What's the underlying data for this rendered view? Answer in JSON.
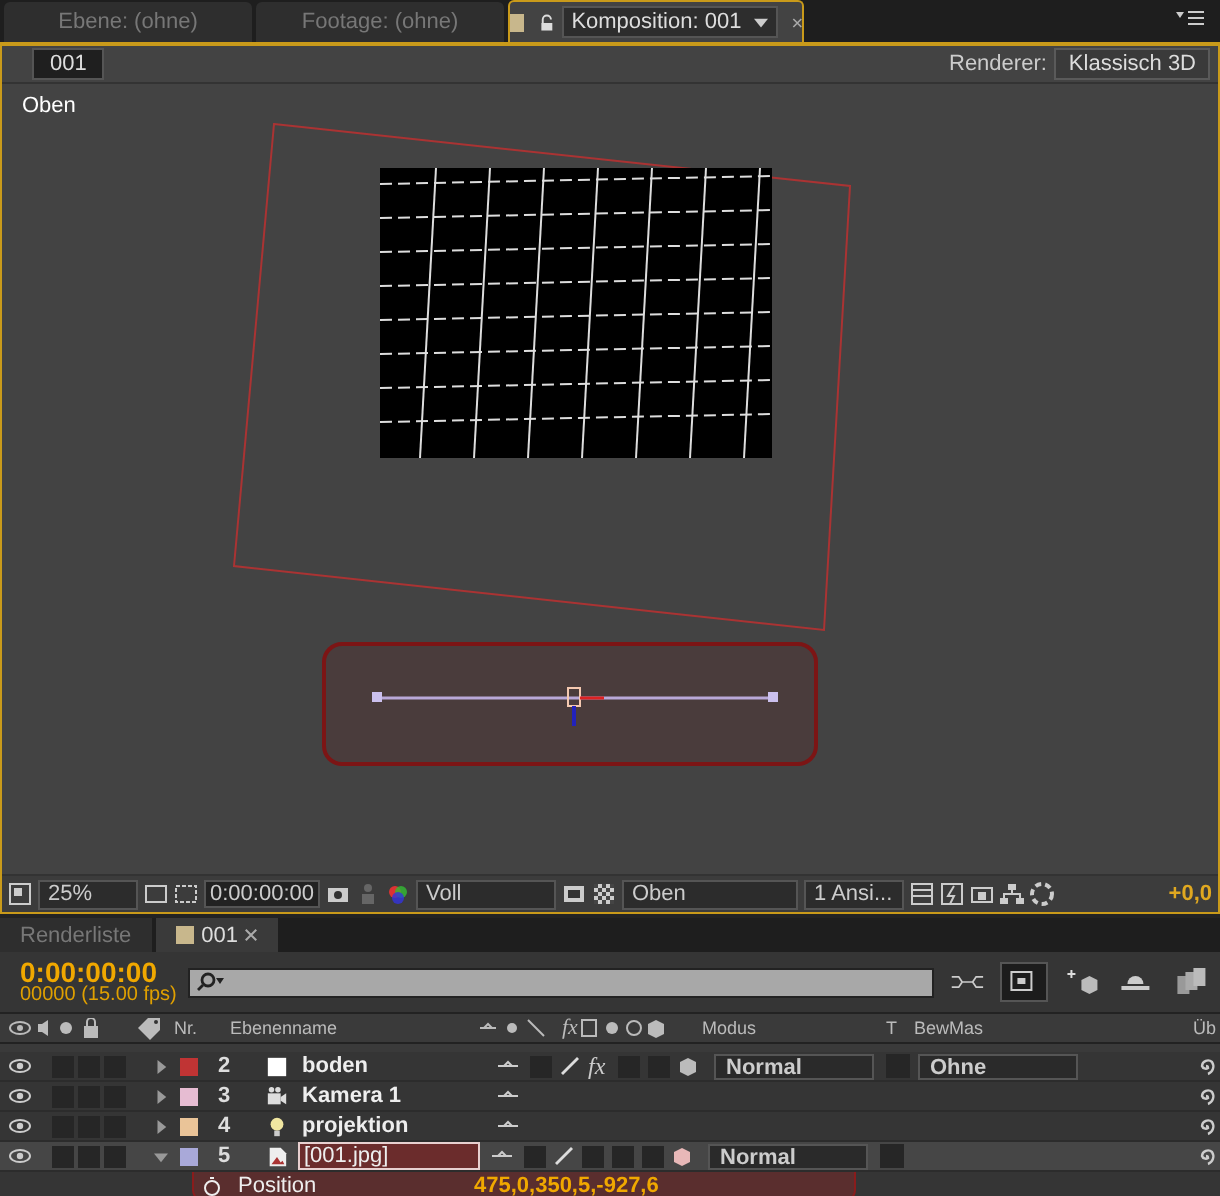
{
  "panel_tabs": [
    {
      "label": "Ebene: (ohne)",
      "selected": false
    },
    {
      "label": "Footage: (ohne)",
      "selected": false
    },
    {
      "label": "Komposition: 001",
      "selected": true
    }
  ],
  "comp_header": {
    "comp_name": "001",
    "renderer_label": "Renderer:",
    "renderer": "Klassisch 3D"
  },
  "viewer": {
    "view_label": "Oben"
  },
  "viewer_toolbar": {
    "zoom": "25%",
    "time": "0:00:00:00",
    "resolution": "Voll",
    "view": "Oben",
    "views": "1 Ansi...",
    "exposure": "+0,0"
  },
  "timeline_tabs": [
    {
      "label": "Renderliste",
      "selected": false
    },
    {
      "label": "001",
      "selected": true,
      "closable": true
    }
  ],
  "timeline": {
    "timecode": "0:00:00:00",
    "frames": "00000 (15.00 fps)",
    "columns": {
      "number": "Nr.",
      "name": "Ebenenname",
      "effects": "fx",
      "mode": "Modus",
      "track": "T",
      "trackmatte": "BewMas",
      "parent": "Üb"
    },
    "layers": [
      {
        "number": "2",
        "name": "boden",
        "kind": "solid",
        "color": "#c03434",
        "expanded": false,
        "selected": false,
        "effects_switch": "fx",
        "mode": "Normal",
        "trackmatte": "Ohne"
      },
      {
        "number": "3",
        "name": "Kamera 1",
        "kind": "camera",
        "color": "#e6bcd2",
        "expanded": false,
        "selected": false
      },
      {
        "number": "4",
        "name": "projektion",
        "kind": "light",
        "color": "#eac498",
        "expanded": false,
        "selected": false
      },
      {
        "number": "5",
        "name": "[001.jpg]",
        "kind": "footage",
        "color": "#a9a9d9",
        "expanded": true,
        "selected": true,
        "mode": "Normal"
      }
    ],
    "property": {
      "name": "Position",
      "value": "475,0,350,5,-927,6"
    }
  }
}
